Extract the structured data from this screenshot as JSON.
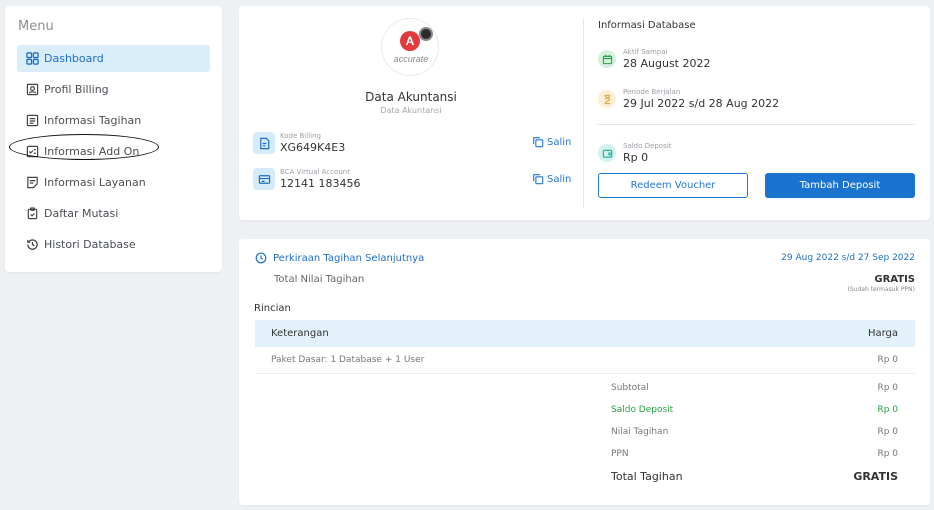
{
  "sidebar": {
    "title": "Menu",
    "items": [
      {
        "label": "Dashboard",
        "icon": "dashboard-icon",
        "active": true
      },
      {
        "label": "Profil Billing",
        "icon": "profile-card-icon"
      },
      {
        "label": "Informasi Tagihan",
        "icon": "invoice-icon"
      },
      {
        "label": "Informasi Add On",
        "icon": "addon-checklist-icon"
      },
      {
        "label": "Informasi Layanan",
        "icon": "service-doc-icon"
      },
      {
        "label": "Daftar Mutasi",
        "icon": "clipboard-icon"
      },
      {
        "label": "Histori Database",
        "icon": "history-icon"
      }
    ]
  },
  "account": {
    "logo_text": "accurate",
    "logo_letter": "A",
    "name": "Data Akuntansi",
    "subtitle": "Data Akuntansi",
    "billing_code_label": "Kode Billing",
    "billing_code": "XG649K4E3",
    "va_label": "BCA Virtual Account",
    "va_number": "12141 183456",
    "copy_label": "Salin"
  },
  "database": {
    "title": "Informasi Database",
    "active_until_label": "Aktif Sampai",
    "active_until": "28 August 2022",
    "period_label": "Periode Berjalan",
    "period": "29 Jul 2022 s/d 28 Aug 2022",
    "deposit_label": "Saldo Deposit",
    "deposit": "Rp 0",
    "redeem_label": "Redeem Voucher",
    "add_deposit_label": "Tambah Deposit"
  },
  "billing": {
    "title": "Perkiraan Tagihan Selanjutnya",
    "period": "29 Aug 2022 s/d 27 Sep 2022",
    "total_label": "Total Nilai Tagihan",
    "total_value": "GRATIS",
    "total_note": "(Sudah termasuk PPN)",
    "details_label": "Rincian",
    "col_description": "Keterangan",
    "col_price": "Harga",
    "rows": [
      {
        "description": "Paket Dasar: 1 Database + 1 User",
        "price": "Rp 0"
      }
    ],
    "summary": [
      {
        "label": "Subtotal",
        "value": "Rp 0"
      },
      {
        "label": "Saldo Deposit",
        "value": "Rp 0"
      },
      {
        "label": "Nilai Tagihan",
        "value": "Rp 0"
      },
      {
        "label": "PPN",
        "value": "Rp 0"
      },
      {
        "label": "Total Tagihan",
        "value": "GRATIS"
      }
    ]
  },
  "colors": {
    "accent": "#1a73cf",
    "active_bg": "#d9edfa",
    "green": "#25a244"
  }
}
